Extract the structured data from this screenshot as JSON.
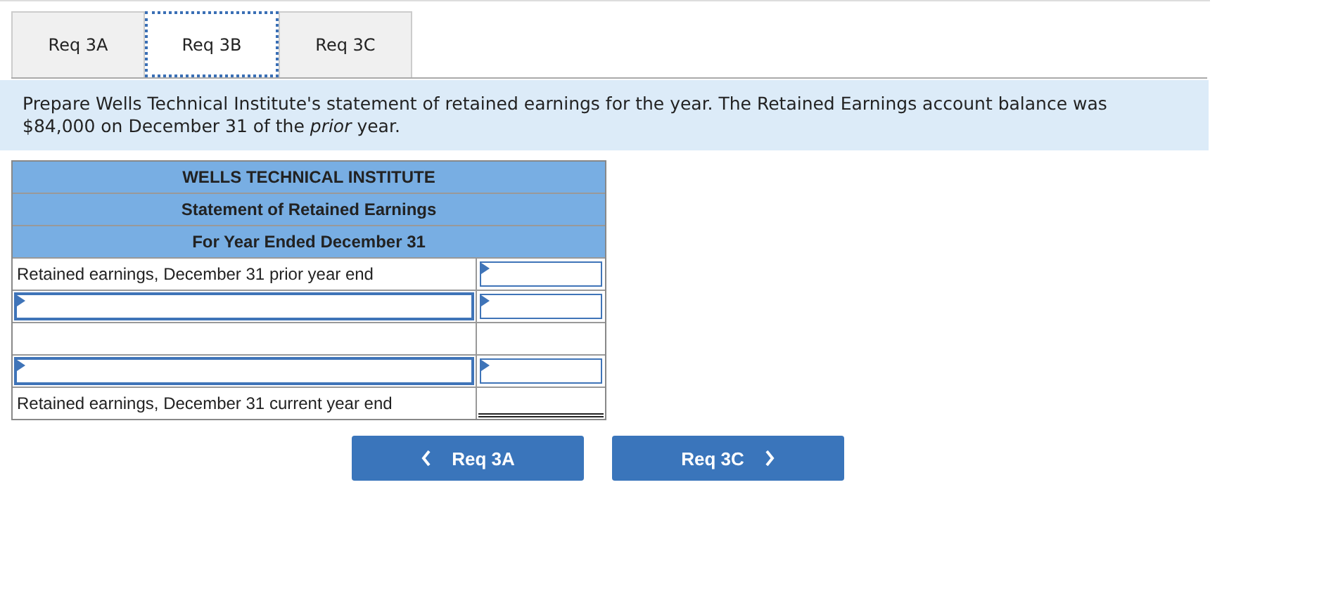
{
  "tabs": [
    {
      "label": "Req 3A",
      "selected": false
    },
    {
      "label": "Req 3B",
      "selected": true
    },
    {
      "label": "Req 3C",
      "selected": false
    }
  ],
  "instructions": "Prepare Wells Technical Institute's statement of retained earnings for the year. The Retained Earnings account balance was $84,000 on December 31 of the *prior* year.",
  "statement": {
    "headers": [
      "WELLS TECHNICAL INSTITUTE",
      "Statement of Retained Earnings",
      "For Year Ended December 31"
    ],
    "rows": [
      {
        "cells": [
          {
            "kind": "text",
            "text": "Retained earnings, December 31 prior year end"
          },
          {
            "kind": "input"
          }
        ]
      },
      {
        "cells": [
          {
            "kind": "input"
          },
          {
            "kind": "input"
          }
        ]
      },
      {
        "cells": [
          {
            "kind": "blank"
          },
          {
            "kind": "blank"
          }
        ]
      },
      {
        "cells": [
          {
            "kind": "input"
          },
          {
            "kind": "input"
          }
        ]
      },
      {
        "cells": [
          {
            "kind": "text",
            "text": "Retained earnings, December 31 current year end"
          },
          {
            "kind": "total"
          }
        ]
      }
    ]
  },
  "nav": {
    "prev": "Req 3A",
    "next": "Req 3C"
  }
}
